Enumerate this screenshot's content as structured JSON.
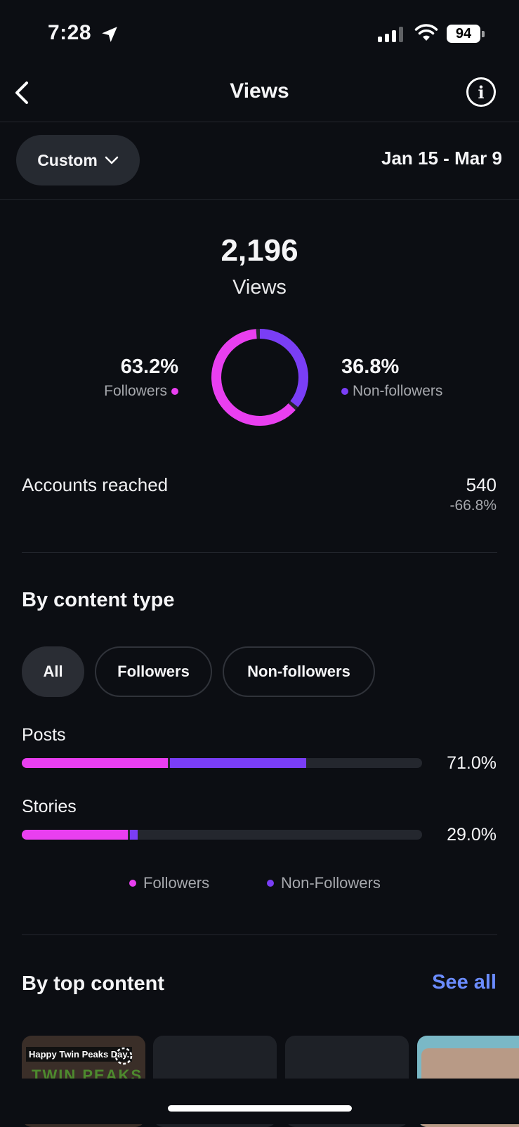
{
  "status_bar": {
    "time": "7:28",
    "battery": "94"
  },
  "header": {
    "title": "Views"
  },
  "date_filter": {
    "preset": "Custom",
    "range": "Jan 15 - Mar 9"
  },
  "summary": {
    "total": "2,196",
    "label": "Views",
    "followers_pct": "63.2%",
    "followers_label": "Followers",
    "nonfollowers_pct": "36.8%",
    "nonfollowers_label": "Non-followers",
    "followers_fraction": 0.632,
    "nonfollowers_fraction": 0.368
  },
  "accounts_reached": {
    "label": "Accounts reached",
    "value": "540",
    "change": "-66.8%"
  },
  "content_type": {
    "title": "By content type",
    "filters": [
      "All",
      "Followers",
      "Non-followers"
    ],
    "active_filter": "All",
    "rows": [
      {
        "label": "Posts",
        "pct": "71.0%",
        "followers_fraction": 0.365,
        "nonfollowers_fraction": 0.345
      },
      {
        "label": "Stories",
        "pct": "29.0%",
        "followers_fraction": 0.265,
        "nonfollowers_fraction": 0.025
      }
    ],
    "legend": {
      "followers": "Followers",
      "nonfollowers": "Non-Followers"
    }
  },
  "top_content": {
    "title": "By top content",
    "see_all": "See all",
    "thumb_caption": "Happy Twin Peaks Day.",
    "thumb_title": "TWIN PEAKS"
  },
  "colors": {
    "followers": "#e93ff0",
    "nonfollowers": "#7a3ef6",
    "accent_link": "#6b8cff",
    "background": "#0c0e13"
  },
  "icons": [
    "location-arrow-icon",
    "cellular-signal-icon",
    "wifi-icon",
    "battery-icon",
    "back-chevron-icon",
    "info-icon",
    "chevron-down-icon",
    "loading-spinner-icon"
  ]
}
